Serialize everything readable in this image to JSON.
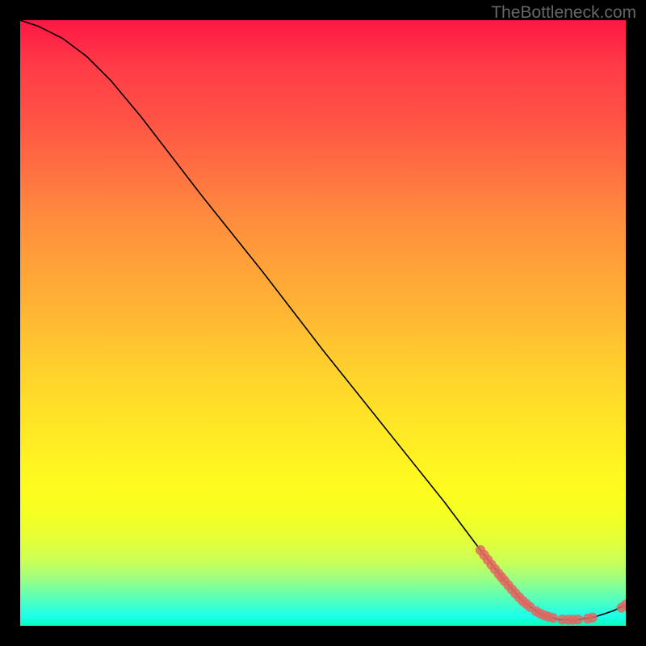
{
  "watermark": "TheBottleneck.com",
  "chart_data": {
    "type": "line",
    "title": "",
    "xlabel": "",
    "ylabel": "",
    "xlim": [
      0,
      100
    ],
    "ylim": [
      0,
      100
    ],
    "curve": [
      {
        "x": 0,
        "y": 100
      },
      {
        "x": 3,
        "y": 99
      },
      {
        "x": 7,
        "y": 97
      },
      {
        "x": 11,
        "y": 94
      },
      {
        "x": 15,
        "y": 90
      },
      {
        "x": 20,
        "y": 84
      },
      {
        "x": 30,
        "y": 71
      },
      {
        "x": 40,
        "y": 58.5
      },
      {
        "x": 50,
        "y": 45.5
      },
      {
        "x": 60,
        "y": 33
      },
      {
        "x": 70,
        "y": 20.5
      },
      {
        "x": 76,
        "y": 12.5
      },
      {
        "x": 80,
        "y": 7.5
      },
      {
        "x": 83,
        "y": 4
      },
      {
        "x": 86,
        "y": 1.9
      },
      {
        "x": 89,
        "y": 1.0
      },
      {
        "x": 92,
        "y": 1.0
      },
      {
        "x": 95,
        "y": 1.5
      },
      {
        "x": 98,
        "y": 2.5
      },
      {
        "x": 100,
        "y": 3.5
      }
    ],
    "markers": [
      {
        "x": 76,
        "y": 12.5
      },
      {
        "x": 76.6,
        "y": 11.7
      },
      {
        "x": 77.2,
        "y": 10.9
      },
      {
        "x": 77.8,
        "y": 10.1
      },
      {
        "x": 78.4,
        "y": 9.35
      },
      {
        "x": 79,
        "y": 8.6
      },
      {
        "x": 79.5,
        "y": 8.0
      },
      {
        "x": 80,
        "y": 7.4
      },
      {
        "x": 80.6,
        "y": 6.7
      },
      {
        "x": 81.2,
        "y": 6.0
      },
      {
        "x": 81.8,
        "y": 5.35
      },
      {
        "x": 82.4,
        "y": 4.7
      },
      {
        "x": 83,
        "y": 4.1
      },
      {
        "x": 83.6,
        "y": 3.6
      },
      {
        "x": 84.2,
        "y": 3.1
      },
      {
        "x": 85.2,
        "y": 2.4
      },
      {
        "x": 85.9,
        "y": 2.0
      },
      {
        "x": 86.6,
        "y": 1.7
      },
      {
        "x": 87.2,
        "y": 1.5
      },
      {
        "x": 88,
        "y": 1.3
      },
      {
        "x": 89.5,
        "y": 1.05
      },
      {
        "x": 90.5,
        "y": 1.0
      },
      {
        "x": 91.3,
        "y": 1.0
      },
      {
        "x": 92.1,
        "y": 1.05
      },
      {
        "x": 93.7,
        "y": 1.2
      },
      {
        "x": 94.5,
        "y": 1.35
      },
      {
        "x": 99.3,
        "y": 3.0
      },
      {
        "x": 100,
        "y": 3.5
      }
    ],
    "marker_color": "#e06660",
    "curve_color": "#000000"
  }
}
